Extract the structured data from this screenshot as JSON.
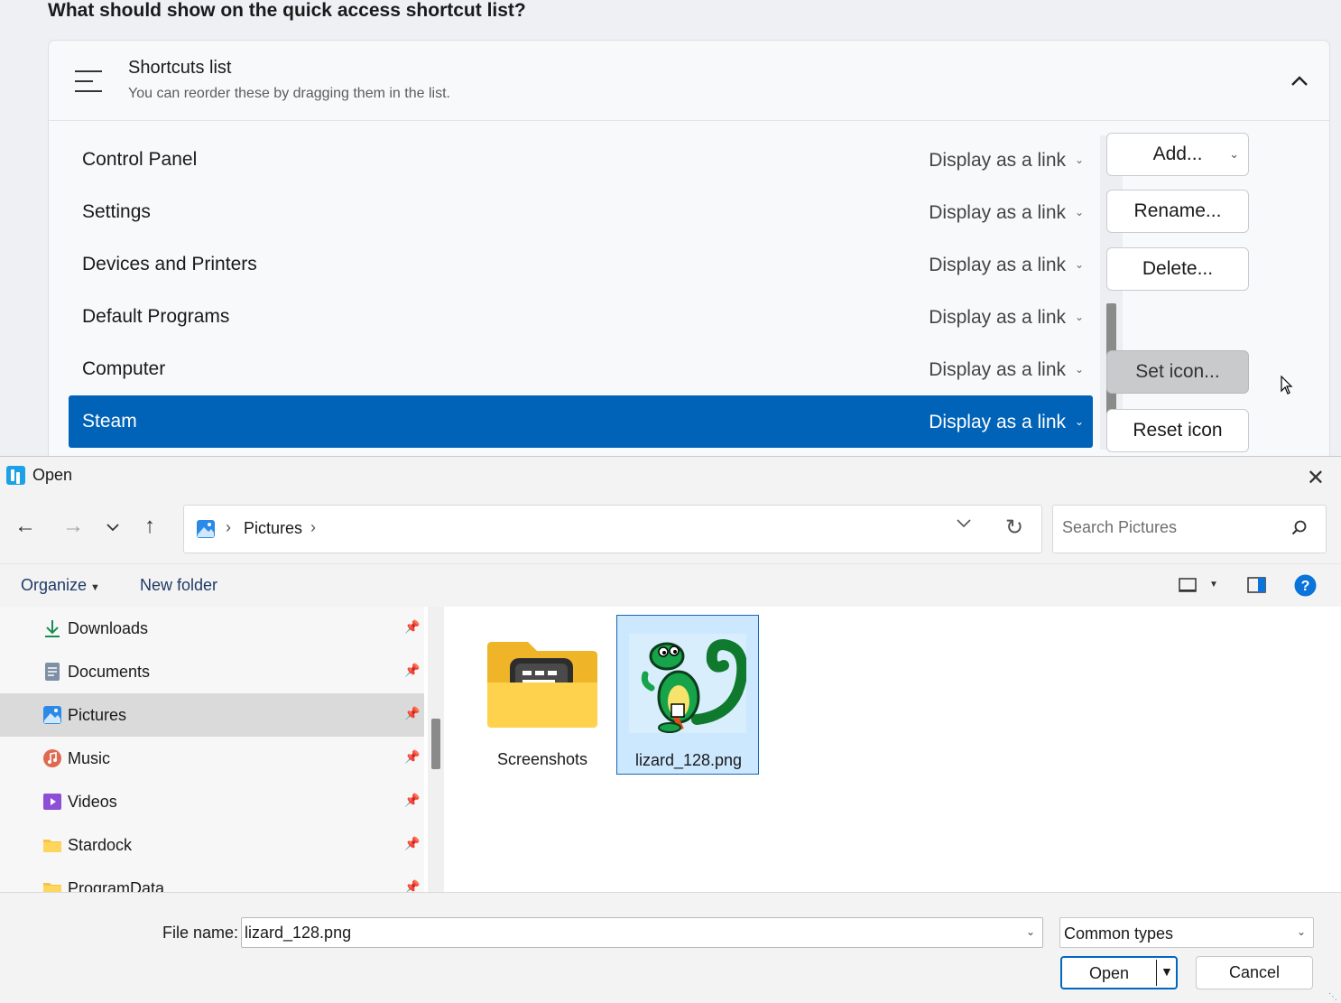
{
  "settings": {
    "question": "What should show on the quick access shortcut list?",
    "card_title": "Shortcuts list",
    "card_subtitle": "You can reorder these by dragging them in the list.",
    "items": [
      {
        "name": "Control Panel",
        "mode": "Display as a link"
      },
      {
        "name": "Settings",
        "mode": "Display as a link"
      },
      {
        "name": "Devices and Printers",
        "mode": "Display as a link"
      },
      {
        "name": "Default Programs",
        "mode": "Display as a link"
      },
      {
        "name": "Computer",
        "mode": "Display as a link"
      },
      {
        "name": "Steam",
        "mode": "Display as a link"
      }
    ],
    "selected_item": "Steam",
    "buttons": {
      "add": "Add...",
      "rename": "Rename...",
      "delete": "Delete...",
      "set_icon": "Set icon...",
      "reset_icon": "Reset icon"
    }
  },
  "dialog": {
    "title": "Open",
    "address": {
      "location": "Pictures"
    },
    "search_placeholder": "Search Pictures",
    "commands": {
      "organize": "Organize",
      "new_folder": "New folder"
    },
    "tree": [
      {
        "label": "Downloads",
        "icon": "downloads-icon"
      },
      {
        "label": "Documents",
        "icon": "documents-icon"
      },
      {
        "label": "Pictures",
        "icon": "pictures-icon"
      },
      {
        "label": "Music",
        "icon": "music-icon"
      },
      {
        "label": "Videos",
        "icon": "videos-icon"
      },
      {
        "label": "Stardock",
        "icon": "folder-icon"
      },
      {
        "label": "ProgramData",
        "icon": "folder-icon"
      }
    ],
    "selected_tree": "Pictures",
    "files": [
      {
        "name": "Screenshots",
        "kind": "folder"
      },
      {
        "name": "lizard_128.png",
        "kind": "image"
      }
    ],
    "selected_file": "lizard_128.png",
    "file_name_label": "File name:",
    "file_name_value": "lizard_128.png",
    "file_type": "Common types",
    "open_label": "Open",
    "cancel_label": "Cancel"
  },
  "colors": {
    "accent": "#0063b8",
    "selection_bg": "#cce8ff",
    "help_blue": "#0a74da"
  }
}
